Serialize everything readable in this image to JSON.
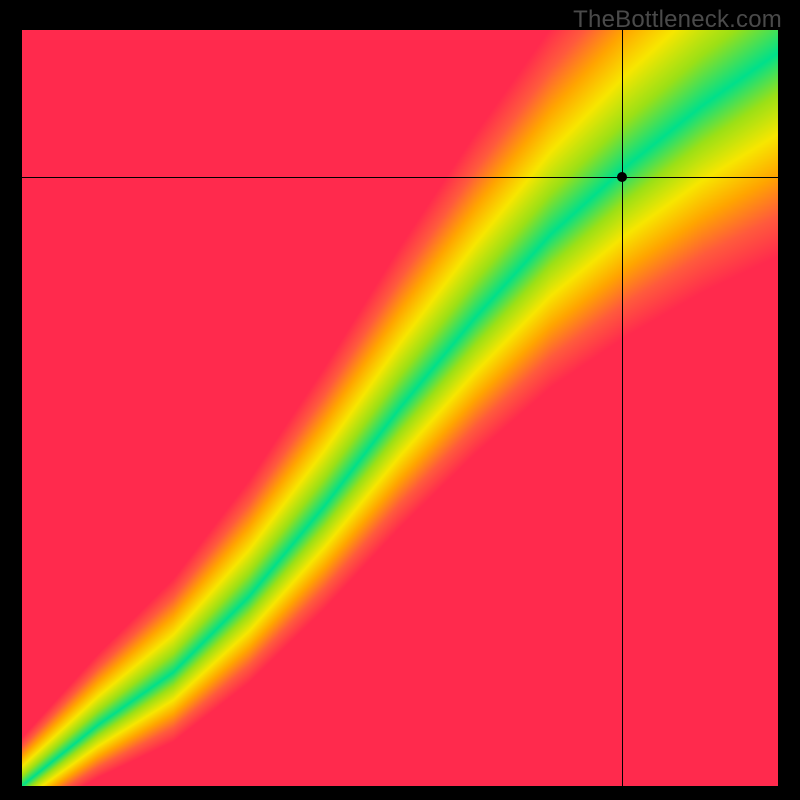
{
  "watermark": "TheBottleneck.com",
  "chart_data": {
    "type": "heatmap",
    "title": "",
    "xlabel": "",
    "ylabel": "",
    "xlim": [
      0,
      1
    ],
    "ylim": [
      0,
      1
    ],
    "grid": false,
    "legend": "none",
    "crosshair": {
      "x": 0.793,
      "y": 0.805
    },
    "marker": {
      "x": 0.793,
      "y": 0.805
    },
    "optimal_band": {
      "description": "green diagonal band where values are balanced; yellow transition; red away from band",
      "center_curve": [
        {
          "x": 0.0,
          "y": 0.0
        },
        {
          "x": 0.1,
          "y": 0.08
        },
        {
          "x": 0.2,
          "y": 0.15
        },
        {
          "x": 0.3,
          "y": 0.25
        },
        {
          "x": 0.4,
          "y": 0.37
        },
        {
          "x": 0.5,
          "y": 0.5
        },
        {
          "x": 0.6,
          "y": 0.62
        },
        {
          "x": 0.7,
          "y": 0.73
        },
        {
          "x": 0.8,
          "y": 0.82
        },
        {
          "x": 0.9,
          "y": 0.9
        },
        {
          "x": 1.0,
          "y": 0.97
        }
      ],
      "band_half_width": 0.06
    },
    "colormap": {
      "stops": [
        {
          "t": 0.0,
          "color": "#00e08a"
        },
        {
          "t": 0.2,
          "color": "#9be016"
        },
        {
          "t": 0.4,
          "color": "#f7e600"
        },
        {
          "t": 0.6,
          "color": "#ffa400"
        },
        {
          "t": 0.8,
          "color": "#ff5a3c"
        },
        {
          "t": 1.0,
          "color": "#ff2a4d"
        }
      ]
    }
  }
}
